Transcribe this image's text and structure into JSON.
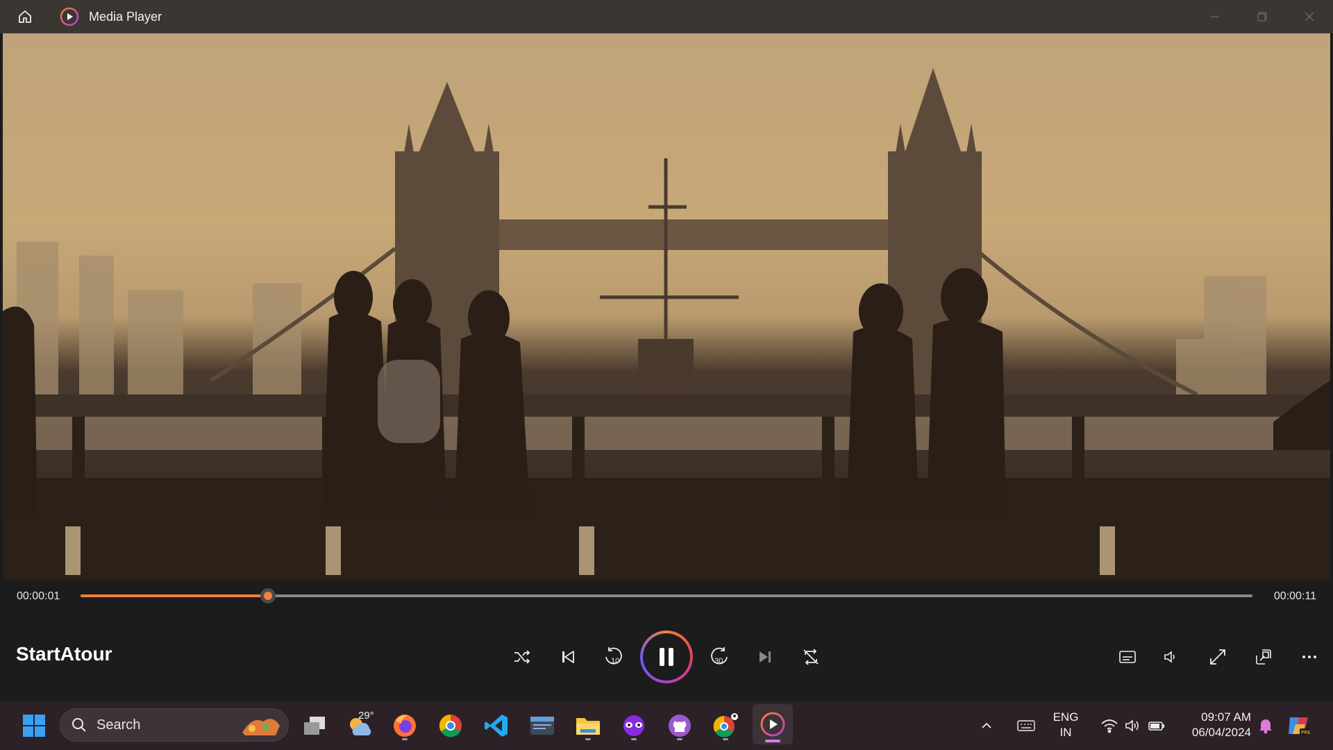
{
  "window": {
    "title": "Media Player",
    "icons": [
      "home-icon",
      "media-player-icon",
      "minimize-icon",
      "restore-icon",
      "close-icon"
    ]
  },
  "player": {
    "current_time": "00:00:01",
    "total_time": "00:00:11",
    "progress": 0.16,
    "media_title": "StartAtour",
    "accent_color": "#f57f3a",
    "buttons": [
      "shuffle-icon",
      "previous-icon",
      "rewind-10-icon",
      "pause-icon",
      "forward-30-icon",
      "next-icon",
      "repeat-off-icon"
    ],
    "rewind_label": "10",
    "forward_label": "30",
    "right_buttons": [
      "captions-icon",
      "volume-icon",
      "fullscreen-icon",
      "mini-player-icon",
      "more-icon"
    ]
  },
  "taskbar": {
    "search_placeholder": "Search",
    "weather_temp": "29°",
    "apps": [
      "windows-start",
      "task-view",
      "weather",
      "firefox",
      "chrome",
      "vscode",
      "terminal",
      "file-explorer",
      "tor-mask",
      "github-desktop",
      "chrome-profile",
      "media-player"
    ],
    "language_top": "ENG",
    "language_bottom": "IN",
    "time": "09:07 AM",
    "date": "06/04/2024"
  }
}
